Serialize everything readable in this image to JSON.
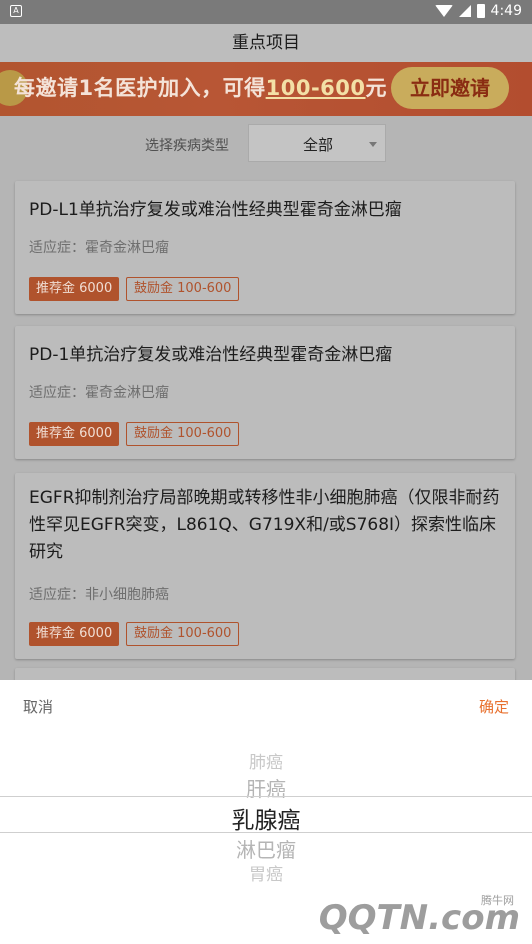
{
  "status_bar": {
    "time": "4:49",
    "left_icon": "A"
  },
  "nav": {
    "title": "重点项目"
  },
  "banner": {
    "text_prefix": "每邀请1名医护加入，可得",
    "amount": "100-600",
    "unit": "元",
    "button": "立即邀请"
  },
  "filter": {
    "label": "选择疾病类型",
    "selected": "全部"
  },
  "cards": [
    {
      "title": "PD-L1单抗治疗复发或难治性经典型霍奇金淋巴瘤",
      "indication": "适应症：霍奇金淋巴瘤",
      "tag_referral": "推荐金 6000",
      "tag_bonus": "鼓励金 100-600"
    },
    {
      "title": "PD-1单抗治疗复发或难治性经典型霍奇金淋巴瘤",
      "indication": "适应症：霍奇金淋巴瘤",
      "tag_referral": "推荐金 6000",
      "tag_bonus": "鼓励金 100-600"
    },
    {
      "title": "EGFR抑制剂治疗局部晚期或转移性非小细胞肺癌（仅限非耐药性罕见EGFR突变，L861Q、G719X和/或S768I）探索性临床研究",
      "indication": "适应症：非小细胞肺癌",
      "tag_referral": "推荐金 6000",
      "tag_bonus": "鼓励金 100-600"
    }
  ],
  "picker": {
    "cancel": "取消",
    "confirm": "确定",
    "options": [
      "肺癌",
      "肝癌",
      "乳腺癌",
      "淋巴瘤",
      "胃癌"
    ],
    "selected": "乳腺癌"
  },
  "watermark": {
    "text": "QQTN.com",
    "small": "腾牛网"
  },
  "icons": [
    "wifi-icon",
    "signal-icon",
    "battery-icon",
    "dropdown-caret-icon",
    "coin-icon"
  ]
}
